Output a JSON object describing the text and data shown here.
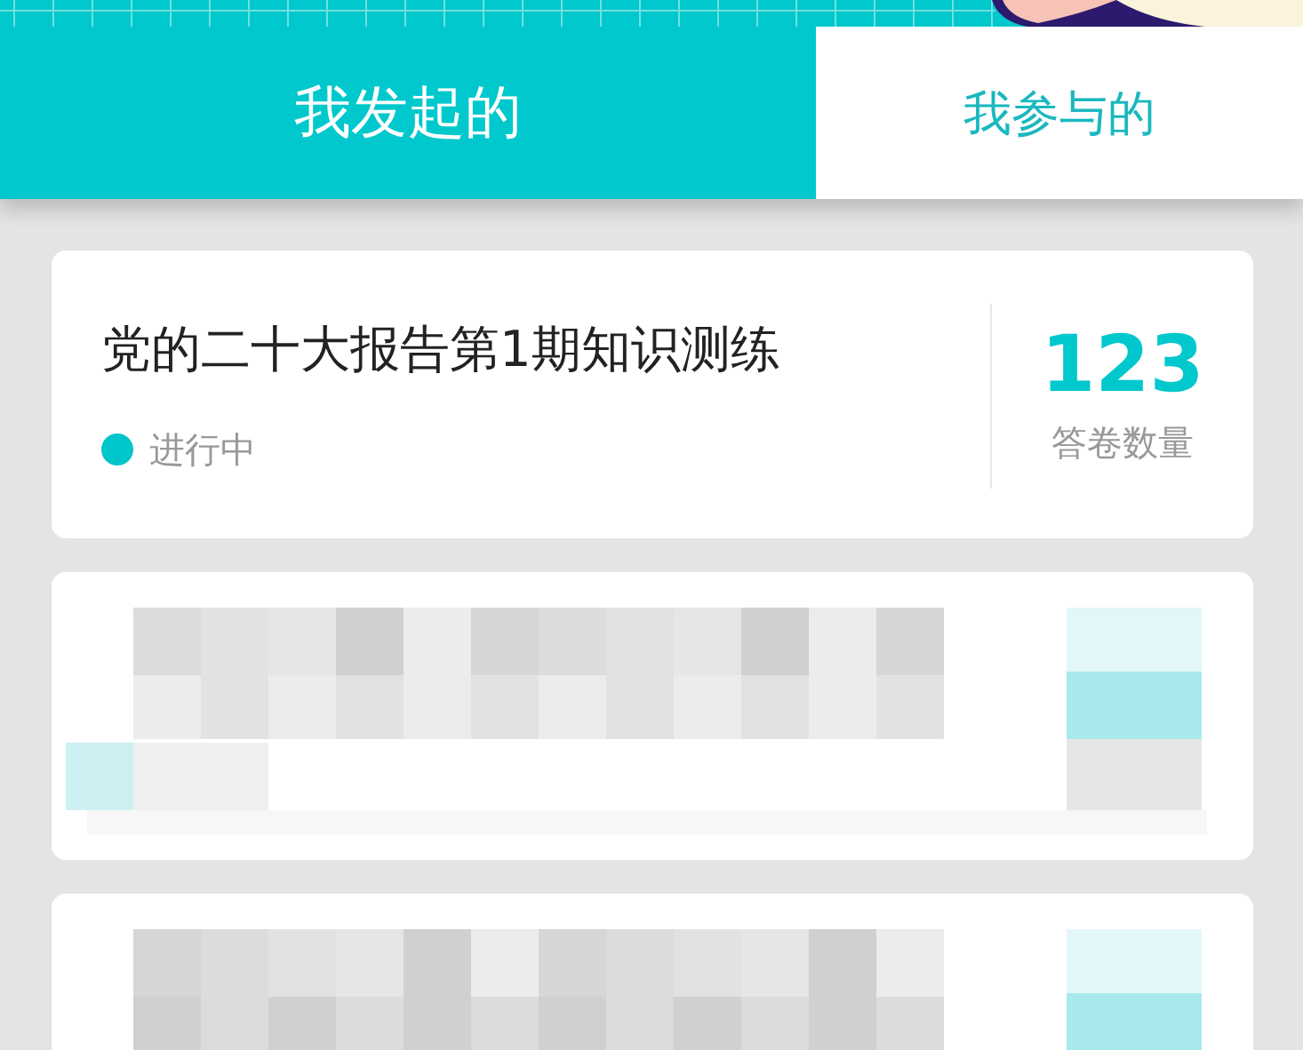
{
  "tabs": [
    {
      "label": "我发起的",
      "selected": true
    },
    {
      "label": "我参与的",
      "selected": false
    }
  ],
  "cards": [
    {
      "kind": "quiz",
      "title": "党的二十大报告第1期知识测练",
      "status": "进行中",
      "color": "#00c5cb",
      "count": "123",
      "count_label": "答卷数量"
    },
    {
      "kind": "redacted"
    },
    {
      "kind": "redacted"
    }
  ]
}
